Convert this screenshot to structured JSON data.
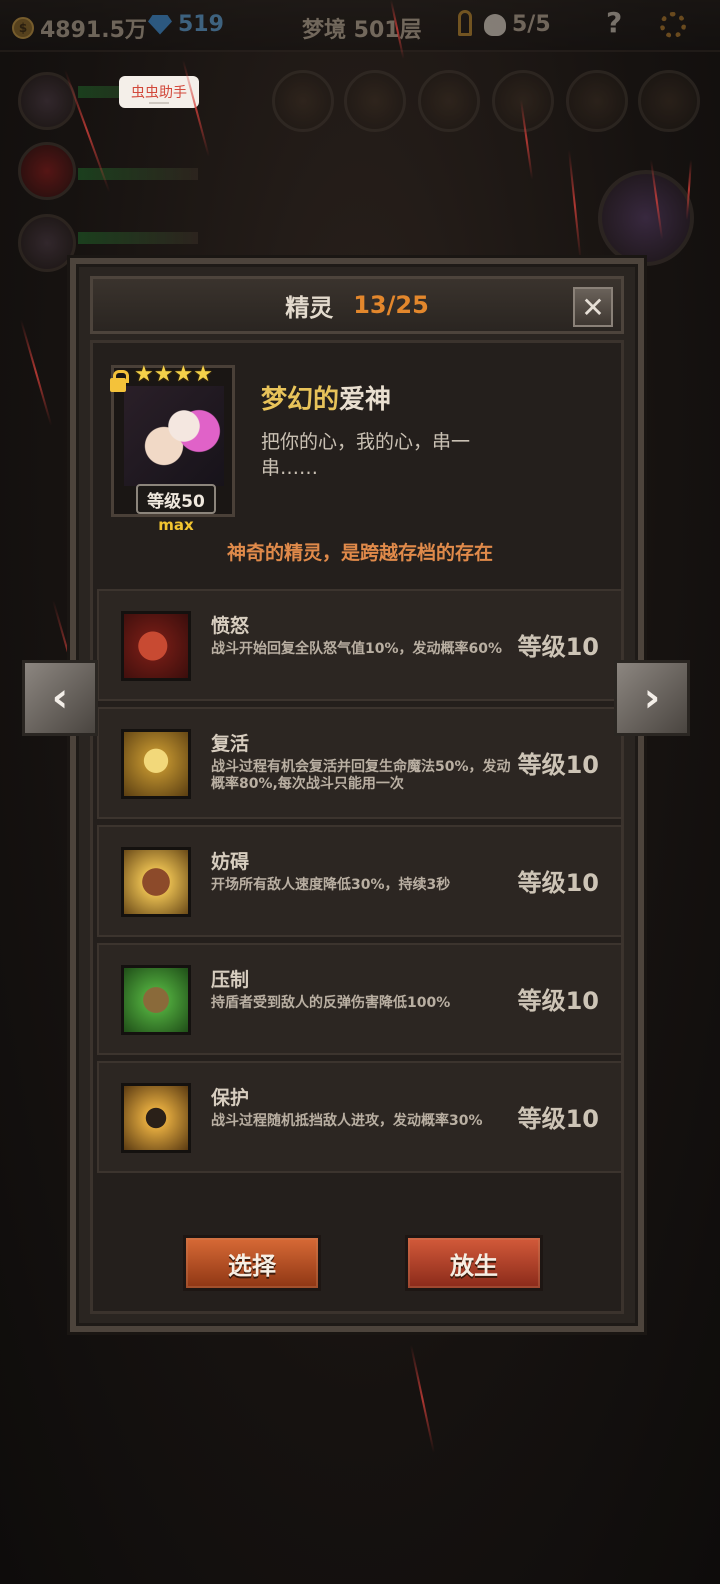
{
  "topbar": {
    "gold": "4891.5万",
    "gems": "519",
    "location": "梦境 501层",
    "skull_count": "5/5",
    "help_symbol": "?"
  },
  "assist_badge": "虫虫助手",
  "panel": {
    "title": "精灵",
    "count": "13/25",
    "close_symbol": "✕"
  },
  "sprite": {
    "stars": [
      "★",
      "★",
      "★",
      "★"
    ],
    "level": "等级50",
    "max": "max",
    "name_part1": "梦幻的",
    "name_part2": "爱神",
    "description": "把你的心，我的心，串一串……",
    "tagline": "神奇的精灵，是跨越存档的存在"
  },
  "skills": [
    {
      "name": "愤怒",
      "desc": "战斗开始回复全队怒气值10%，发动概率60%",
      "level": "等级10",
      "icon": "anger-icon"
    },
    {
      "name": "复活",
      "desc": "战斗过程有机会复活并回复生命魔法50%，发动概率80%,每次战斗只能用一次",
      "level": "等级10",
      "icon": "revive-icon"
    },
    {
      "name": "妨碍",
      "desc": "开场所有敌人速度降低30%，持续3秒",
      "level": "等级10",
      "icon": "hinder-icon"
    },
    {
      "name": "压制",
      "desc": "持盾者受到敌人的反弹伤害降低100%",
      "level": "等级10",
      "icon": "suppress-icon"
    },
    {
      "name": "保护",
      "desc": "战斗过程随机抵挡敌人进攻，发动概率30%",
      "level": "等级10",
      "icon": "protect-icon"
    }
  ],
  "buttons": {
    "select": "选择",
    "release": "放生"
  },
  "nav": {
    "prev": "‹",
    "next": "›"
  },
  "colors": {
    "title_accent": "#e3872c",
    "tagline": "#e08a4a",
    "name_gold": "#e8c35a",
    "select_button": "#c45a2a",
    "release_button": "#b84632"
  }
}
